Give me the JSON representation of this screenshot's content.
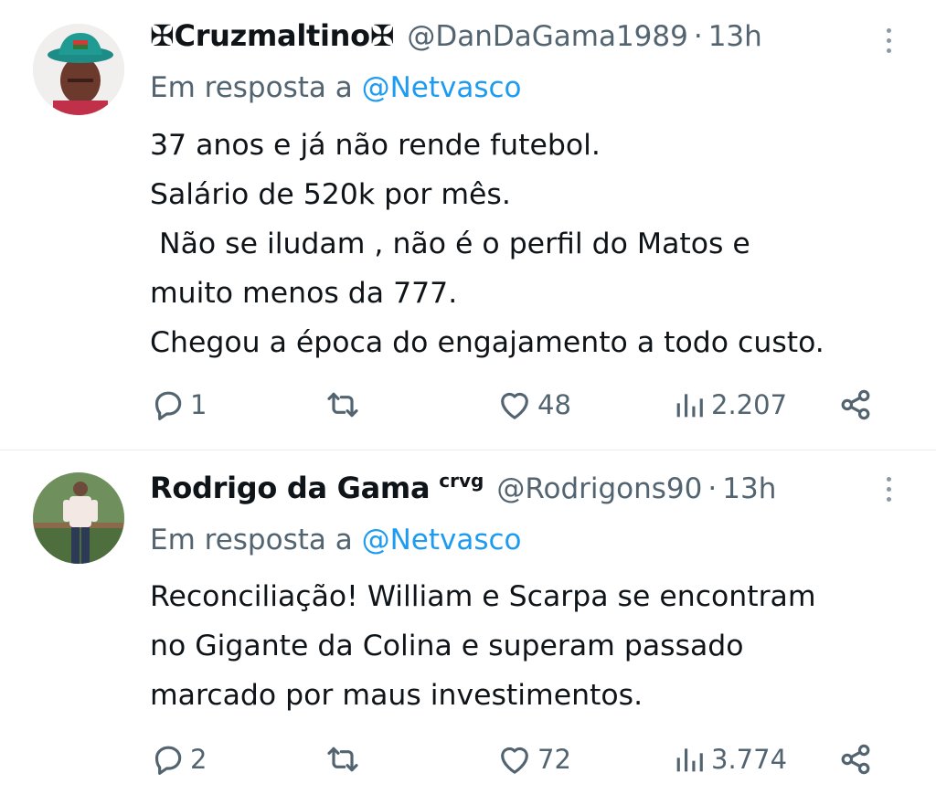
{
  "tweets": [
    {
      "display_name": "✠Cruzmaltino✠",
      "handle": "@DanDaGama1989",
      "time": "13h",
      "reply_prefix": "Em resposta a",
      "reply_to": "@Netvasco",
      "lines": [
        "37 anos e já não rende futebol.",
        "Salário de 520k por mês.",
        " Não se iludam , não é o perfil do Matos e",
        "muito menos da 777.",
        "Chegou a época do engajamento a todo custo."
      ],
      "replies": "1",
      "likes": "48",
      "views": "2.207"
    },
    {
      "display_name": "Rodrigo da Gama",
      "name_suffix": "crvg",
      "handle": "@Rodrigons90",
      "time": "13h",
      "reply_prefix": "Em resposta a",
      "reply_to": "@Netvasco",
      "lines": [
        "Reconciliação! William e Scarpa se encontram",
        "no Gigante da Colina e superam passado",
        "marcado por maus investimentos."
      ],
      "replies": "2",
      "likes": "72",
      "views": "3.774"
    }
  ],
  "colors": {
    "text": "#0f1419",
    "secondary": "#536471",
    "link": "#1d9bf0",
    "divider": "#e6ecf0"
  },
  "icons": [
    "reply-icon",
    "retweet-icon",
    "like-icon",
    "views-icon",
    "share-icon",
    "more-icon"
  ]
}
